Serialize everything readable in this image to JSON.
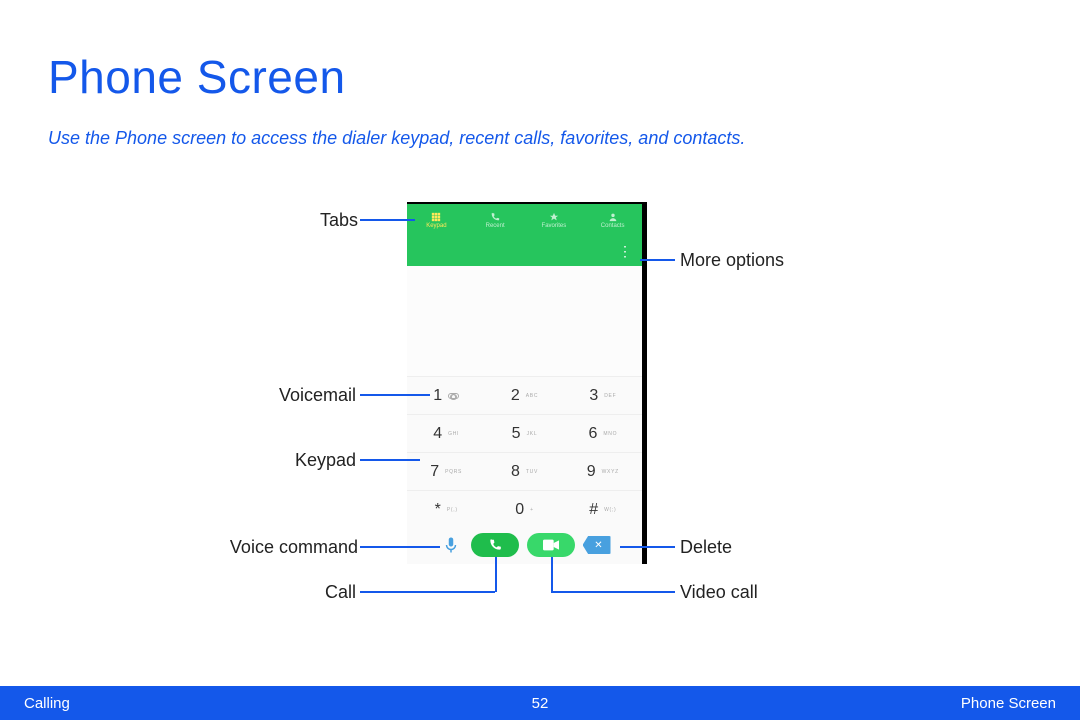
{
  "title": "Phone Screen",
  "subtitle": "Use the Phone screen to access the dialer keypad, recent calls, favorites, and contacts.",
  "phone": {
    "tabs": [
      {
        "label": "Keypad",
        "active": true
      },
      {
        "label": "Recent",
        "active": false
      },
      {
        "label": "Favorites",
        "active": false
      },
      {
        "label": "Contacts",
        "active": false
      }
    ],
    "keypad": [
      [
        {
          "num": "1",
          "let": ""
        },
        {
          "num": "2",
          "let": "ABC"
        },
        {
          "num": "3",
          "let": "DEF"
        }
      ],
      [
        {
          "num": "4",
          "let": "GHI"
        },
        {
          "num": "5",
          "let": "JKL"
        },
        {
          "num": "6",
          "let": "MNO"
        }
      ],
      [
        {
          "num": "7",
          "let": "PQRS"
        },
        {
          "num": "8",
          "let": "TUV"
        },
        {
          "num": "9",
          "let": "WXYZ"
        }
      ],
      [
        {
          "num": "*",
          "let": "P(,)"
        },
        {
          "num": "0",
          "let": "+"
        },
        {
          "num": "#",
          "let": "W(;)"
        }
      ]
    ]
  },
  "callouts": {
    "tabs": "Tabs",
    "more_options": "More options",
    "voicemail": "Voicemail",
    "keypad": "Keypad",
    "voice_command": "Voice command",
    "call": "Call",
    "delete": "Delete",
    "video_call": "Video call"
  },
  "footer": {
    "left": "Calling",
    "page": "52",
    "right": "Phone Screen"
  }
}
